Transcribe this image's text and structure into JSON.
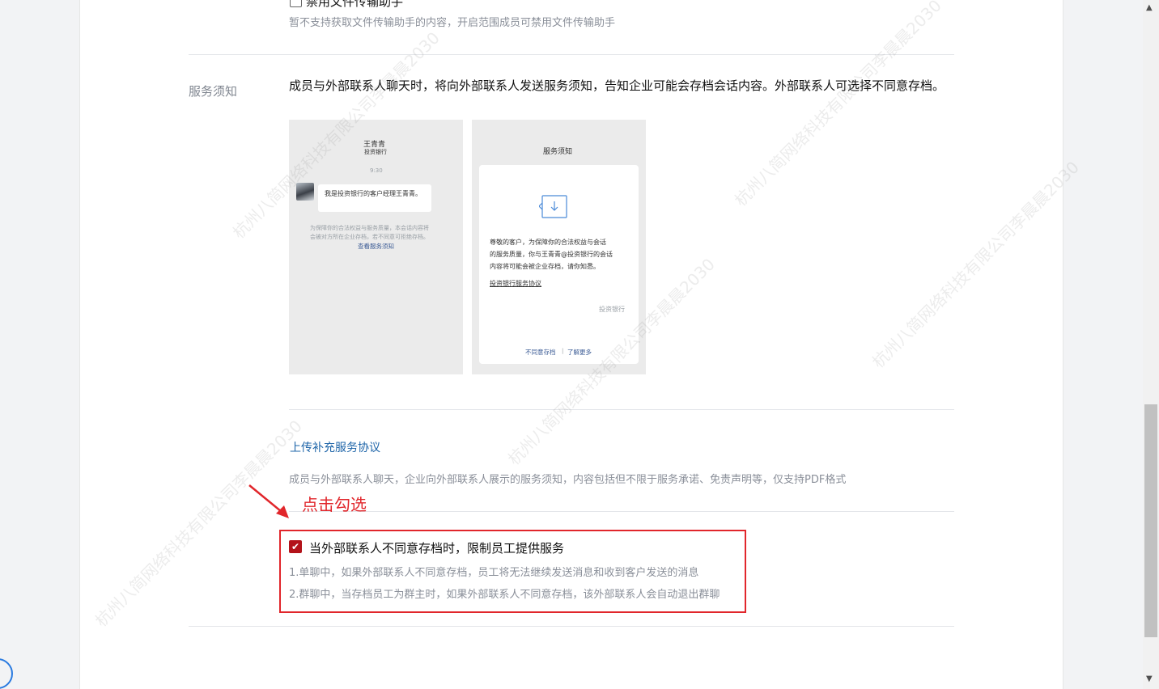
{
  "top": {
    "checkbox_label": "禁用文件传输助手",
    "note": "暂不支持获取文件传输助手的内容，开启范围成员可禁用文件传输助手"
  },
  "service_notice": {
    "section_label": "服务须知",
    "description": "成员与外部联系人聊天时，将向外部联系人发送服务须知，告知企业可能会存档会话内容。外部联系人可选择不同意存档。",
    "preview_chat": {
      "name": "王青青",
      "company": "投资银行",
      "time": "9:30",
      "message": "我是投资银行的客户经理王青青。",
      "notice_text_1": "为保障你的合法权益与服务质量，本会话内容将",
      "notice_text_2": "会被对方所在企业存档，若不同意可拒绝存档。",
      "notice_link": "查看服务须知"
    },
    "preview_notice": {
      "title": "服务须知",
      "body_1": "尊敬的客户，为保障你的合法权益与会话",
      "body_2": "的服务质量，你与王青青@投资银行的会话",
      "body_3": "内容将可能会被企业存档，请你知悉。",
      "agreement_link": "投资银行服务协议",
      "signature": "投资银行",
      "disagree": "不同意存档",
      "separator": "|",
      "learn_more": "了解更多"
    }
  },
  "upload": {
    "link": "上传补充服务协议",
    "description": "成员与外部联系人聊天，企业向外部联系人展示的服务须知，内容包括但不限于服务承诺、免责声明等，仅支持PDF格式"
  },
  "annotation": "点击勾选",
  "restrict": {
    "checked": true,
    "label": "当外部联系人不同意存档时，限制员工提供服务",
    "rule_1": "1.单聊中，如果外部联系人不同意存档，员工将无法继续发送消息和收到客户发送的消息",
    "rule_2": "2.群聊中，当存档员工为群主时，如果外部联系人不同意存档，该外部联系人会自动退出群聊"
  },
  "watermark": "杭州八简网络科技有限公司李晨晨2030",
  "colors": {
    "accent_red": "#e1262b",
    "checkbox_red": "#b3131a",
    "link_blue": "#1d64a8"
  }
}
